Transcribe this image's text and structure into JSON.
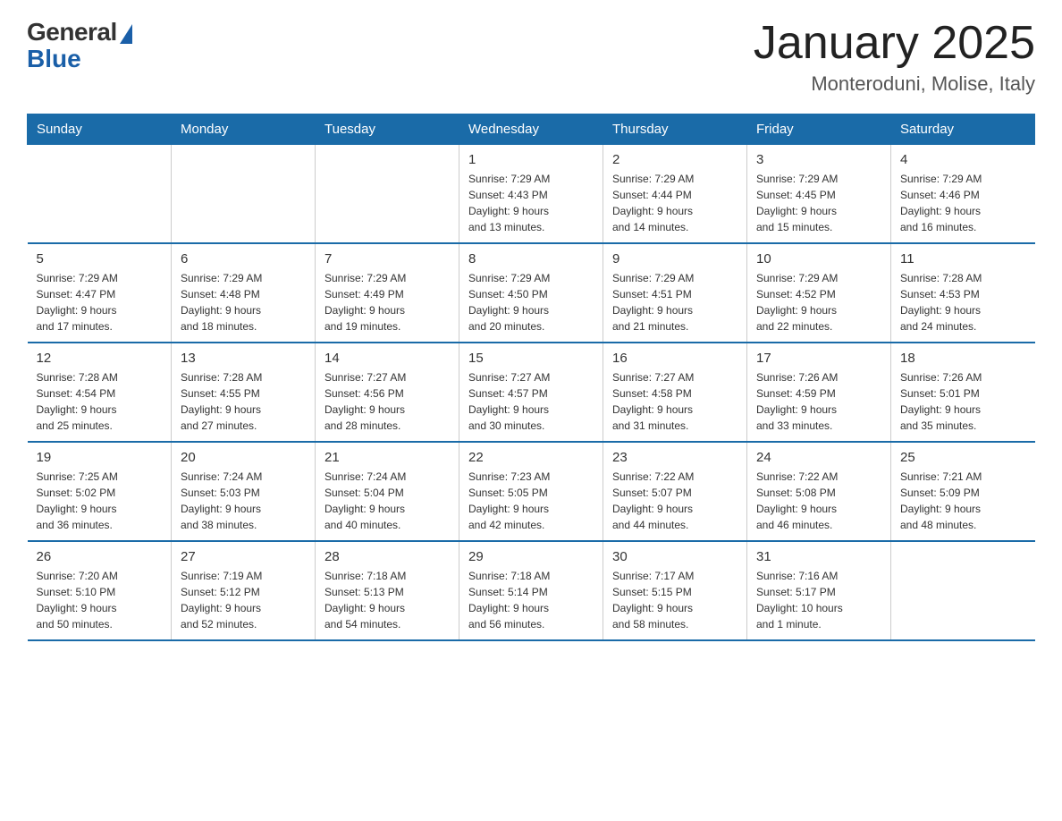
{
  "header": {
    "logo_general": "General",
    "logo_blue": "Blue",
    "title": "January 2025",
    "location": "Monteroduni, Molise, Italy"
  },
  "weekdays": [
    "Sunday",
    "Monday",
    "Tuesday",
    "Wednesday",
    "Thursday",
    "Friday",
    "Saturday"
  ],
  "weeks": [
    [
      {
        "day": "",
        "info": ""
      },
      {
        "day": "",
        "info": ""
      },
      {
        "day": "",
        "info": ""
      },
      {
        "day": "1",
        "info": "Sunrise: 7:29 AM\nSunset: 4:43 PM\nDaylight: 9 hours\nand 13 minutes."
      },
      {
        "day": "2",
        "info": "Sunrise: 7:29 AM\nSunset: 4:44 PM\nDaylight: 9 hours\nand 14 minutes."
      },
      {
        "day": "3",
        "info": "Sunrise: 7:29 AM\nSunset: 4:45 PM\nDaylight: 9 hours\nand 15 minutes."
      },
      {
        "day": "4",
        "info": "Sunrise: 7:29 AM\nSunset: 4:46 PM\nDaylight: 9 hours\nand 16 minutes."
      }
    ],
    [
      {
        "day": "5",
        "info": "Sunrise: 7:29 AM\nSunset: 4:47 PM\nDaylight: 9 hours\nand 17 minutes."
      },
      {
        "day": "6",
        "info": "Sunrise: 7:29 AM\nSunset: 4:48 PM\nDaylight: 9 hours\nand 18 minutes."
      },
      {
        "day": "7",
        "info": "Sunrise: 7:29 AM\nSunset: 4:49 PM\nDaylight: 9 hours\nand 19 minutes."
      },
      {
        "day": "8",
        "info": "Sunrise: 7:29 AM\nSunset: 4:50 PM\nDaylight: 9 hours\nand 20 minutes."
      },
      {
        "day": "9",
        "info": "Sunrise: 7:29 AM\nSunset: 4:51 PM\nDaylight: 9 hours\nand 21 minutes."
      },
      {
        "day": "10",
        "info": "Sunrise: 7:29 AM\nSunset: 4:52 PM\nDaylight: 9 hours\nand 22 minutes."
      },
      {
        "day": "11",
        "info": "Sunrise: 7:28 AM\nSunset: 4:53 PM\nDaylight: 9 hours\nand 24 minutes."
      }
    ],
    [
      {
        "day": "12",
        "info": "Sunrise: 7:28 AM\nSunset: 4:54 PM\nDaylight: 9 hours\nand 25 minutes."
      },
      {
        "day": "13",
        "info": "Sunrise: 7:28 AM\nSunset: 4:55 PM\nDaylight: 9 hours\nand 27 minutes."
      },
      {
        "day": "14",
        "info": "Sunrise: 7:27 AM\nSunset: 4:56 PM\nDaylight: 9 hours\nand 28 minutes."
      },
      {
        "day": "15",
        "info": "Sunrise: 7:27 AM\nSunset: 4:57 PM\nDaylight: 9 hours\nand 30 minutes."
      },
      {
        "day": "16",
        "info": "Sunrise: 7:27 AM\nSunset: 4:58 PM\nDaylight: 9 hours\nand 31 minutes."
      },
      {
        "day": "17",
        "info": "Sunrise: 7:26 AM\nSunset: 4:59 PM\nDaylight: 9 hours\nand 33 minutes."
      },
      {
        "day": "18",
        "info": "Sunrise: 7:26 AM\nSunset: 5:01 PM\nDaylight: 9 hours\nand 35 minutes."
      }
    ],
    [
      {
        "day": "19",
        "info": "Sunrise: 7:25 AM\nSunset: 5:02 PM\nDaylight: 9 hours\nand 36 minutes."
      },
      {
        "day": "20",
        "info": "Sunrise: 7:24 AM\nSunset: 5:03 PM\nDaylight: 9 hours\nand 38 minutes."
      },
      {
        "day": "21",
        "info": "Sunrise: 7:24 AM\nSunset: 5:04 PM\nDaylight: 9 hours\nand 40 minutes."
      },
      {
        "day": "22",
        "info": "Sunrise: 7:23 AM\nSunset: 5:05 PM\nDaylight: 9 hours\nand 42 minutes."
      },
      {
        "day": "23",
        "info": "Sunrise: 7:22 AM\nSunset: 5:07 PM\nDaylight: 9 hours\nand 44 minutes."
      },
      {
        "day": "24",
        "info": "Sunrise: 7:22 AM\nSunset: 5:08 PM\nDaylight: 9 hours\nand 46 minutes."
      },
      {
        "day": "25",
        "info": "Sunrise: 7:21 AM\nSunset: 5:09 PM\nDaylight: 9 hours\nand 48 minutes."
      }
    ],
    [
      {
        "day": "26",
        "info": "Sunrise: 7:20 AM\nSunset: 5:10 PM\nDaylight: 9 hours\nand 50 minutes."
      },
      {
        "day": "27",
        "info": "Sunrise: 7:19 AM\nSunset: 5:12 PM\nDaylight: 9 hours\nand 52 minutes."
      },
      {
        "day": "28",
        "info": "Sunrise: 7:18 AM\nSunset: 5:13 PM\nDaylight: 9 hours\nand 54 minutes."
      },
      {
        "day": "29",
        "info": "Sunrise: 7:18 AM\nSunset: 5:14 PM\nDaylight: 9 hours\nand 56 minutes."
      },
      {
        "day": "30",
        "info": "Sunrise: 7:17 AM\nSunset: 5:15 PM\nDaylight: 9 hours\nand 58 minutes."
      },
      {
        "day": "31",
        "info": "Sunrise: 7:16 AM\nSunset: 5:17 PM\nDaylight: 10 hours\nand 1 minute."
      },
      {
        "day": "",
        "info": ""
      }
    ]
  ]
}
